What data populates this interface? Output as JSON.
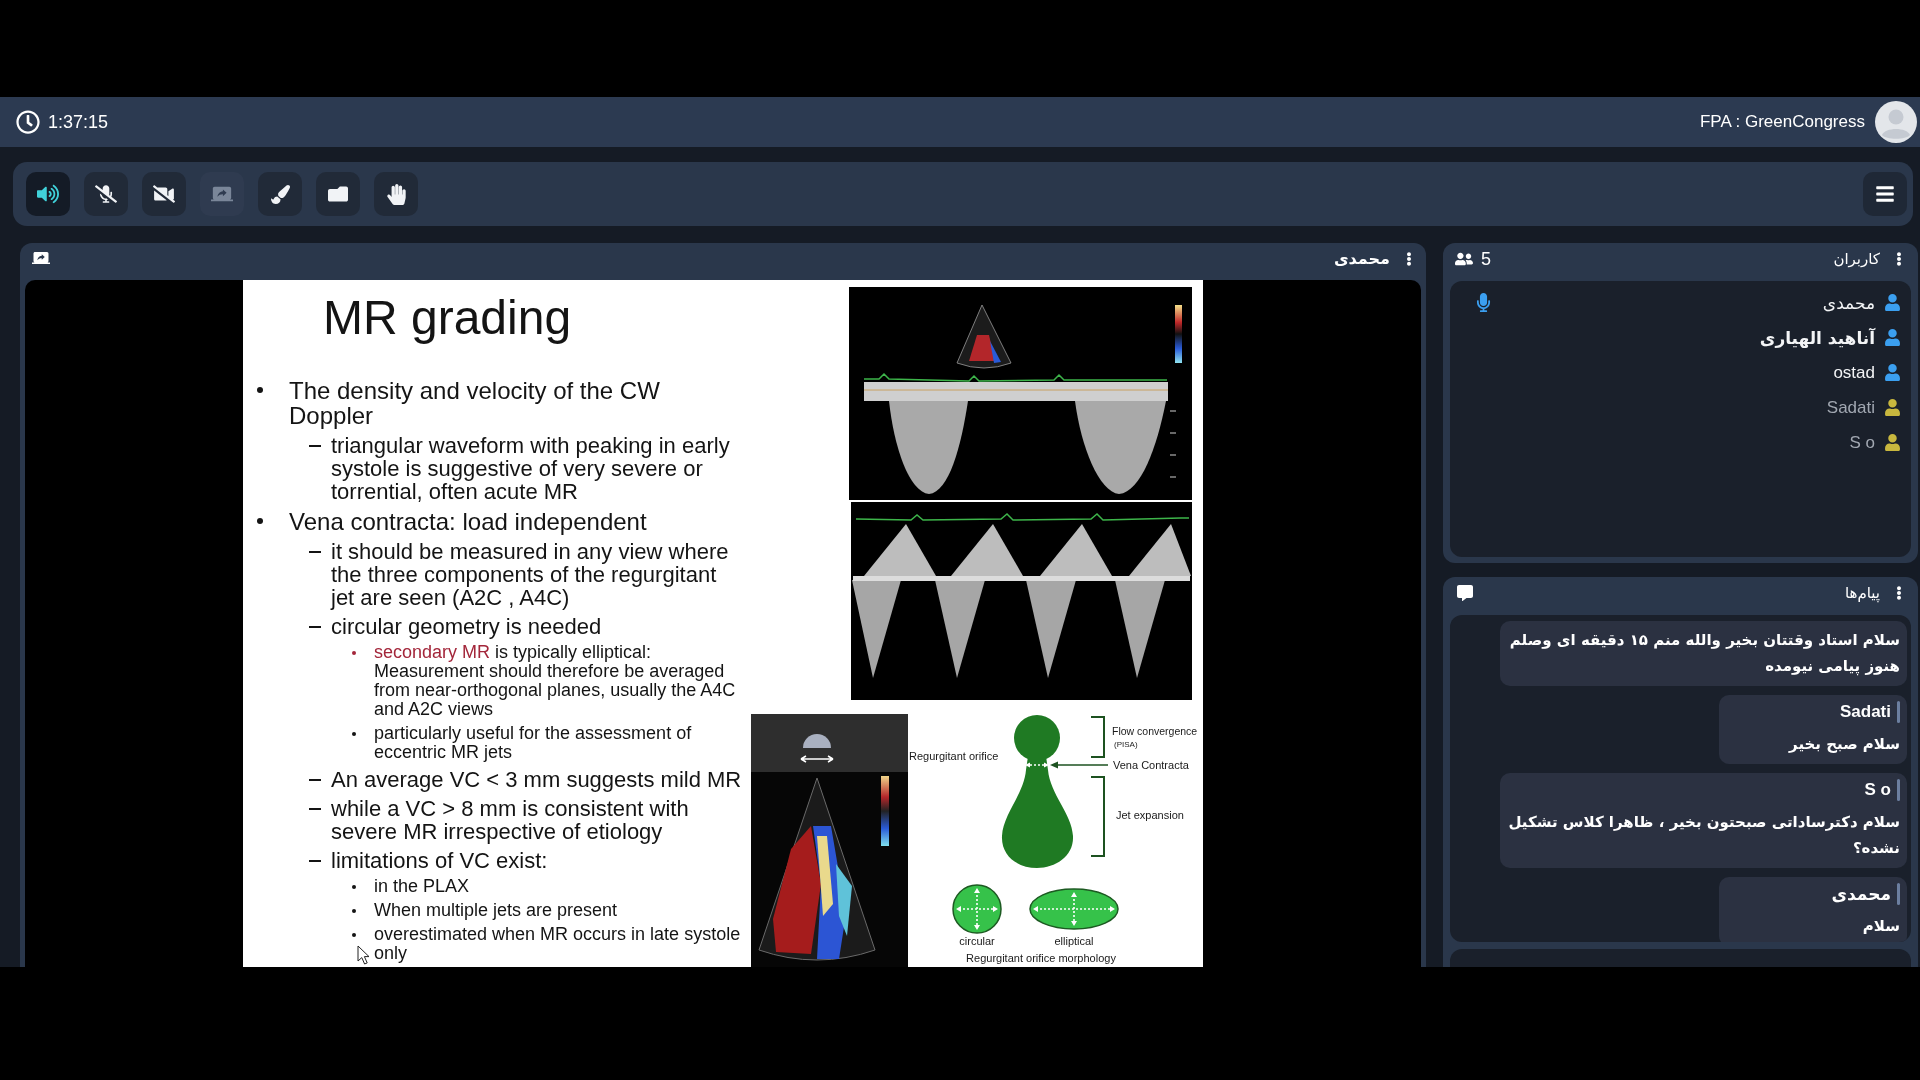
{
  "header": {
    "elapsed": "1:37:15",
    "title": "FPA : GreenCongress"
  },
  "toolbar": {
    "buttons": [
      {
        "kind": "speaker",
        "active": true,
        "disabled": false
      },
      {
        "kind": "mic_off",
        "active": false,
        "disabled": false
      },
      {
        "kind": "camera_off",
        "active": false,
        "disabled": false
      },
      {
        "kind": "share_screen",
        "active": false,
        "disabled": true
      },
      {
        "kind": "draw",
        "active": false,
        "disabled": false
      },
      {
        "kind": "files",
        "active": false,
        "disabled": false
      },
      {
        "kind": "raise_hand",
        "active": false,
        "disabled": false
      }
    ]
  },
  "stage": {
    "presenter": "محمدی",
    "slide": {
      "title": "MR grading",
      "bullets": [
        {
          "text": "The density and velocity of the CW Doppler",
          "children": [
            {
              "text": "triangular waveform with peaking in early systole is suggestive of very severe or torrential, often acute MR"
            }
          ]
        },
        {
          "text": "Vena contracta: load independent",
          "children": [
            {
              "text": "it should be measured in any view where the three components of the regurgitant jet are seen (A2C , A4C)"
            },
            {
              "text": "circular geometry is needed",
              "children": [
                {
                  "lead": "secondary MR",
                  "text": "is typically elliptical: Measurement should therefore be averaged from near-orthogonal planes, usually the A4C and A2C views"
                },
                {
                  "text": "particularly useful for the assessment of eccentric MR jets"
                }
              ]
            },
            {
              "text": "An average VC < 3 mm suggests mild MR"
            },
            {
              "text": "while a VC > 8 mm is consistent with severe MR irrespective of etiology"
            },
            {
              "text": "limitations of VC exist:",
              "children": [
                {
                  "text": "in the PLAX"
                },
                {
                  "text": "When multiple jets are present"
                },
                {
                  "text": "overestimated when MR occurs in late systole only"
                }
              ]
            }
          ]
        }
      ],
      "diagram": {
        "orifice_label": "Regurgitant orifice",
        "convergence_label": "Flow convergence",
        "convergence_note": "(PISA)",
        "contracta_label": "Vena Contracta",
        "expansion_label": "Jet expansion",
        "shapes": [
          {
            "kind": "circle",
            "label": "circular"
          },
          {
            "kind": "ellipse",
            "label": "elliptical"
          }
        ],
        "caption": "Regurgitant orifice morphology"
      }
    }
  },
  "users": {
    "title": "کاربران",
    "count": "5",
    "items": [
      {
        "name": "محمدی",
        "color": "#3b9ff0",
        "kind": "moderator",
        "current": false,
        "talking": true
      },
      {
        "name": "آناهید الهیاری",
        "color": "#3b9ff0",
        "kind": "moderator",
        "current": true,
        "talking": false
      },
      {
        "name": "ostad",
        "color": "#3b9ff0",
        "kind": "moderator",
        "current": false,
        "talking": false
      },
      {
        "name": "Sadati",
        "color": "#c8b73e",
        "kind": "viewer",
        "current": false,
        "talking": false
      },
      {
        "name": "S o",
        "color": "#c8b73e",
        "kind": "viewer",
        "current": false,
        "talking": false
      }
    ]
  },
  "messages": {
    "title": "پیام‌ها",
    "items": [
      {
        "text": "سلام استاد وقتتان بخیر والله منم ۱۵ دقیقه ای وصلم هنوز پیامی نیومده"
      },
      {
        "sender": "Sadati",
        "text": "سلام صبح بخیر"
      },
      {
        "sender": "S o",
        "text": "سلام دکترساداتی صبحتون بخیر ، ظاهرا کلاس تشکیل نشده؟"
      },
      {
        "sender": "محمدی",
        "text": "سلام"
      }
    ]
  }
}
